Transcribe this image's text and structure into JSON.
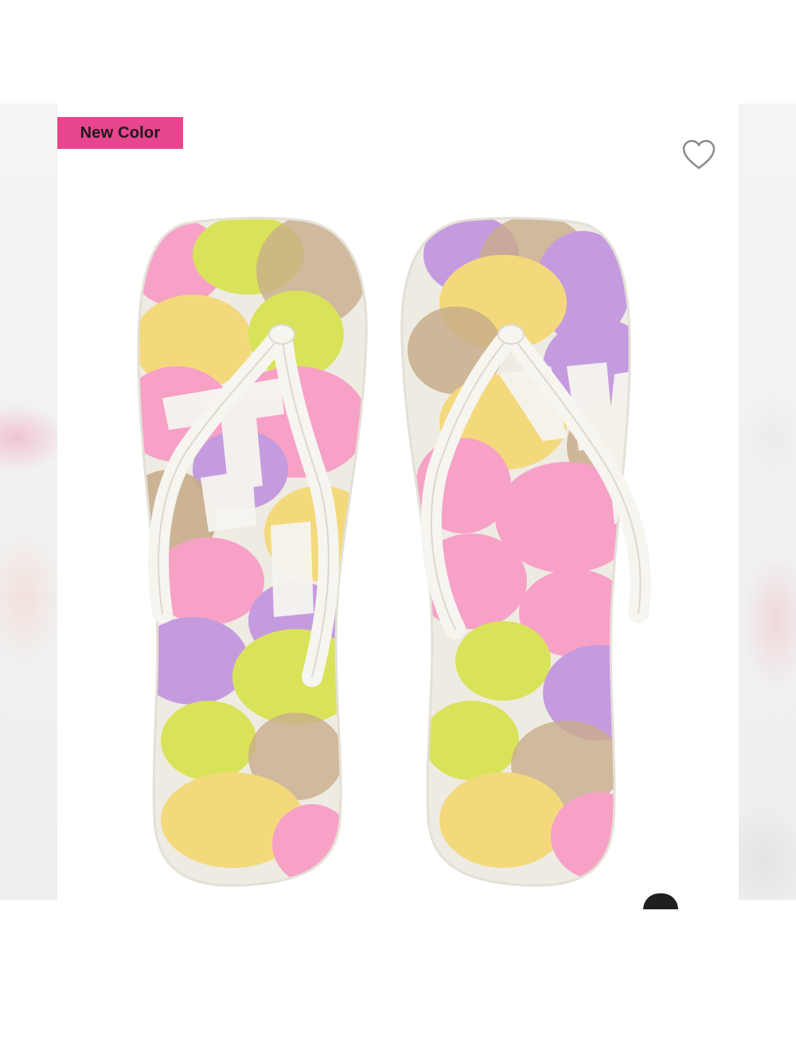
{
  "badge": {
    "label": "New Color",
    "color": "#e8458f"
  },
  "favorite": {
    "icon": "heart-outline-icon"
  },
  "product": {
    "image": "floral-flip-flops-image",
    "print_letters": [
      "P",
      "I",
      "N",
      "K"
    ],
    "strap_logo": "PINK",
    "colors": {
      "strap": "#f6f5ef",
      "pink": "#f7a1c7",
      "yellow": "#f3d97c",
      "lime": "#d9e35a",
      "purple": "#c59be0",
      "tan": "#c8ad8b",
      "base": "#eeebe2"
    }
  }
}
